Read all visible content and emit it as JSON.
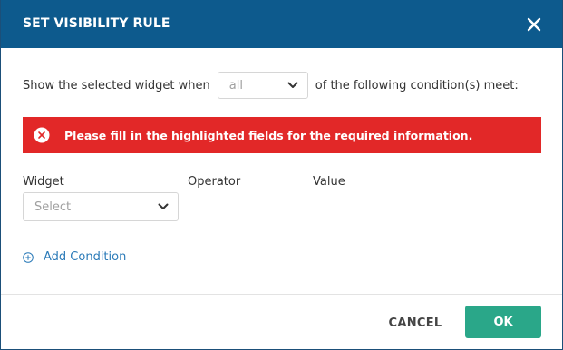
{
  "dialog": {
    "title": "SET VISIBILITY RULE",
    "close_icon": "close-icon"
  },
  "rule": {
    "prefix": "Show the selected widget when",
    "match_value": "all",
    "suffix": "of the following condition(s) meet:"
  },
  "alert": {
    "icon": "error-circle-icon",
    "message": "Please fill in the highlighted fields for the required information.",
    "color": "#e22828"
  },
  "columns": {
    "widget": "Widget",
    "operator": "Operator",
    "value": "Value"
  },
  "widget_select": {
    "placeholder": "Select"
  },
  "add_condition": {
    "label": "Add Condition",
    "icon": "plus-circle-icon"
  },
  "footer": {
    "cancel_label": "CANCEL",
    "ok_label": "OK"
  },
  "colors": {
    "header": "#0d5a8d",
    "accent": "#2aa789",
    "link": "#2a7ab8"
  }
}
